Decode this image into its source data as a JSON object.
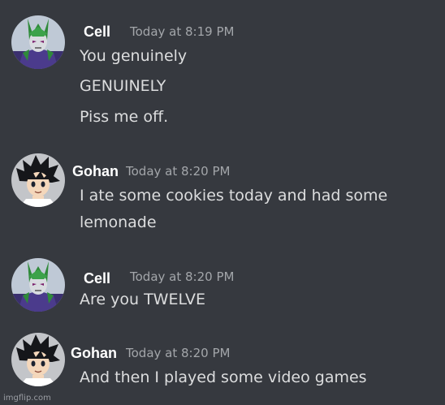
{
  "messages": [
    {
      "author": "Cell",
      "avatar_icon": "cell-avatar-icon",
      "timestamp": "Today at 8:19 PM",
      "lines": [
        "You genuinely",
        "GENUINELY",
        "Piss me off."
      ]
    },
    {
      "author": "Gohan",
      "avatar_icon": "gohan-avatar-icon",
      "timestamp": "Today at 8:20 PM",
      "lines": [
        "I ate some cookies today and had some",
        "lemonade"
      ]
    },
    {
      "author": "Cell",
      "avatar_icon": "cell-avatar-icon",
      "timestamp": "Today at 8:20 PM",
      "lines": [
        "Are you TWELVE"
      ]
    },
    {
      "author": "Gohan",
      "avatar_icon": "gohan-avatar-icon",
      "timestamp": "Today at 8:20 PM",
      "lines": [
        "And then I played some video games"
      ]
    }
  ],
  "watermark": "imgflip.com",
  "colors": {
    "background": "#36393f",
    "author": "#ffffff",
    "timestamp": "#a3a6aa",
    "message": "#dcddde"
  }
}
